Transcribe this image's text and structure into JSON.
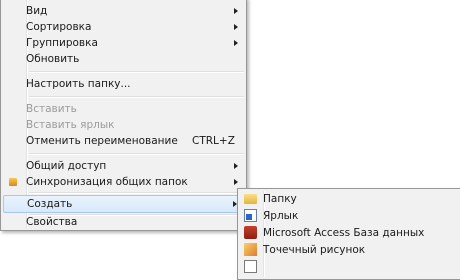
{
  "context_menu": {
    "items": [
      {
        "label": "Вид",
        "submenu": true
      },
      {
        "label": "Сортировка",
        "submenu": true
      },
      {
        "label": "Группировка",
        "submenu": true
      },
      {
        "label": "Обновить"
      },
      {
        "label": "Настроить папку..."
      },
      {
        "label": "Вставить",
        "disabled": true
      },
      {
        "label": "Вставить ярлык",
        "disabled": true
      },
      {
        "label": "Отменить переименование",
        "shortcut": "CTRL+Z"
      },
      {
        "label": "Общий доступ",
        "submenu": true
      },
      {
        "label": "Синхронизация общих папок",
        "submenu": true,
        "icon": "sync-icon"
      },
      {
        "label": "Создать",
        "submenu": true,
        "highlighted": true
      },
      {
        "label": "Свойства"
      }
    ]
  },
  "create_submenu": {
    "items": [
      {
        "label": "Папку",
        "icon": "folder-icon"
      },
      {
        "label": "Ярлык",
        "icon": "shortcut-icon"
      },
      {
        "label": "Microsoft Access База данных",
        "icon": "access-icon"
      },
      {
        "label": "Точечный рисунок",
        "icon": "bitmap-icon"
      },
      {
        "label": "",
        "icon": "document-icon"
      }
    ]
  }
}
